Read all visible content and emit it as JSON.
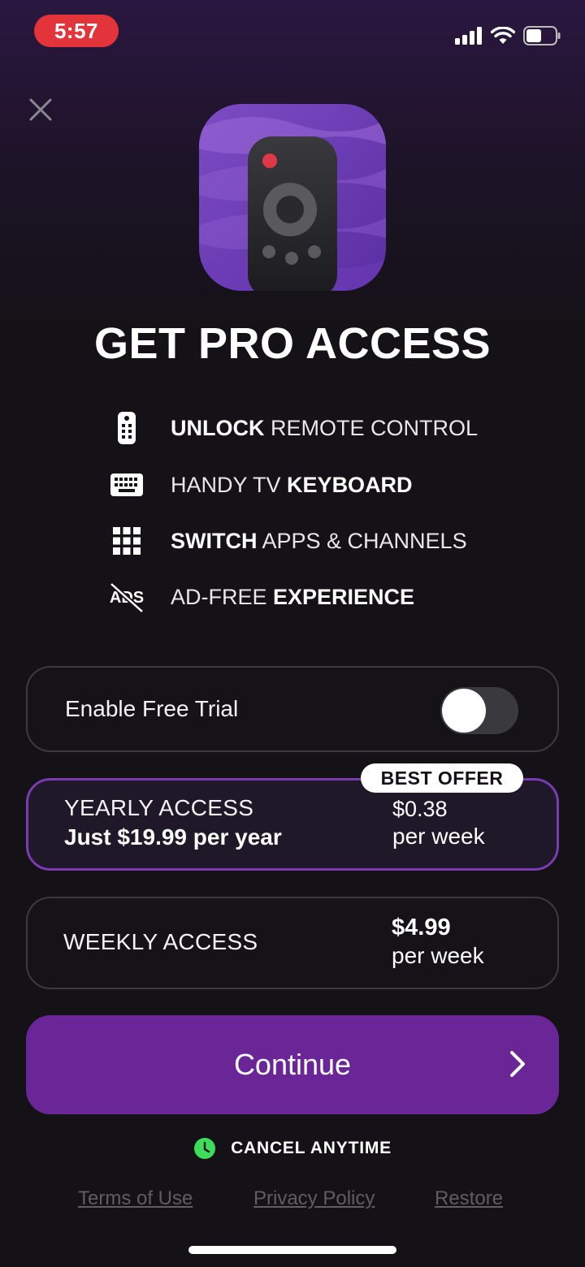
{
  "status_bar": {
    "time": "5:57"
  },
  "header": {
    "close_icon": "close-icon"
  },
  "title": "GET PRO ACCESS",
  "features": [
    {
      "icon": "remote-icon",
      "parts": [
        {
          "text": "UNLOCK",
          "bold": true
        },
        {
          "text": " REMOTE CONTROL",
          "bold": false
        }
      ]
    },
    {
      "icon": "keyboard-icon",
      "parts": [
        {
          "text": "HANDY TV ",
          "bold": false
        },
        {
          "text": "KEYBOARD",
          "bold": true
        }
      ]
    },
    {
      "icon": "apps-grid-icon",
      "parts": [
        {
          "text": "SWITCH",
          "bold": true
        },
        {
          "text": " APPS & CHANNELS",
          "bold": false
        }
      ]
    },
    {
      "icon": "no-ads-icon",
      "icon_text": "ADS",
      "parts": [
        {
          "text": "AD-FREE ",
          "bold": false
        },
        {
          "text": "EXPERIENCE",
          "bold": true
        }
      ]
    }
  ],
  "trial": {
    "label": "Enable Free Trial",
    "enabled": false
  },
  "plans": {
    "yearly": {
      "badge": "BEST OFFER",
      "name": "YEARLY ACCESS",
      "subtitle": "Just $19.99 per year",
      "price": "$0.38",
      "per": "per week",
      "selected": true
    },
    "weekly": {
      "name": "WEEKLY ACCESS",
      "price": "$4.99",
      "per": "per week",
      "selected": false
    }
  },
  "continue_label": "Continue",
  "cancel_text": "CANCEL ANYTIME",
  "links": {
    "terms": "Terms of Use",
    "privacy": "Privacy Policy",
    "restore": "Restore"
  },
  "colors": {
    "accent": "#6a2597",
    "selected_border": "#7a3ab0",
    "cancel_dot": "#3ddc5a"
  }
}
